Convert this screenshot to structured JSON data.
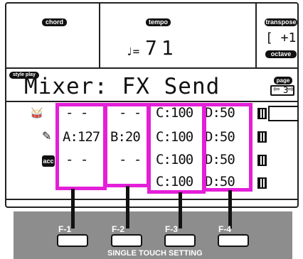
{
  "header": {
    "chord_label": "chord",
    "tempo_label": "tempo",
    "tempo_symbol": "♩=",
    "tempo_value": "71",
    "transpose_label": "transpose",
    "transpose_value": "[ +1",
    "octave_label": "octave"
  },
  "mode": {
    "style_play_label": "style play"
  },
  "page": {
    "title": "Mixer: FX Send",
    "page_label": "page",
    "page_value": "3"
  },
  "rows": [
    {
      "icon": "drum-kit-icon",
      "a": "- -",
      "b": "- -",
      "c": "C:100",
      "d": "D:50"
    },
    {
      "icon": "guitar-icon",
      "a": "A:127",
      "b": "B:20",
      "c": "C:100",
      "d": "D:50"
    },
    {
      "icon": "acc-icon",
      "icon_text": "acc",
      "a": "- -",
      "b": "- -",
      "c": "C:100",
      "d": "D:50"
    },
    {
      "icon": "",
      "a": "",
      "b": "",
      "c": "C:100",
      "d": "D:50"
    }
  ],
  "function_buttons": {
    "f1": "F-1",
    "f2": "F-2",
    "f3": "F-3",
    "f4": "F-4",
    "caption": "SINGLE TOUCH SETTING"
  }
}
